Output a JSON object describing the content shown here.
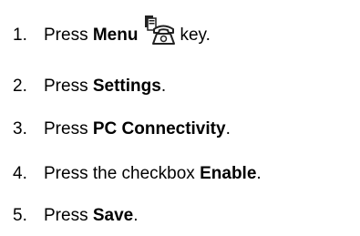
{
  "steps": [
    {
      "number": "1.",
      "before": "Press",
      "bold": "Menu",
      "after": "key.",
      "icon": "menu-key-icon"
    },
    {
      "number": "2.",
      "before": "Press",
      "bold": "Settings",
      "after": "."
    },
    {
      "number": "3.",
      "before": "Press",
      "bold": "PC Connectivity",
      "after": "."
    },
    {
      "number": "4.",
      "before": "Press the checkbox",
      "bold": "Enable",
      "after": "."
    },
    {
      "number": "5.",
      "before": "Press",
      "bold": "Save",
      "after": "."
    }
  ]
}
